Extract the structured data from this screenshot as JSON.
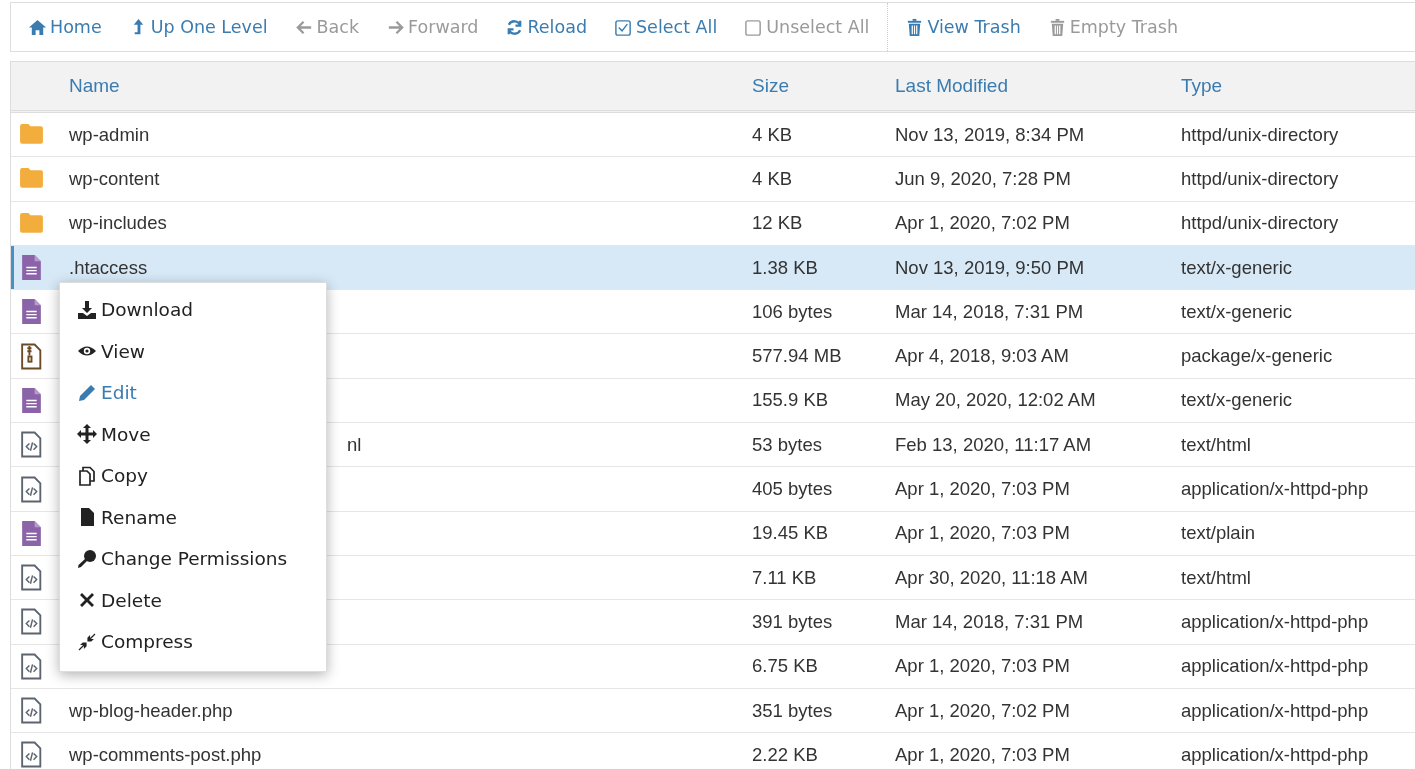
{
  "toolbar": [
    {
      "label": "Home",
      "kind": "home",
      "disabled": false,
      "separator_before": false
    },
    {
      "label": "Up One Level",
      "kind": "up",
      "disabled": false,
      "separator_before": false
    },
    {
      "label": "Back",
      "kind": "back",
      "disabled": true,
      "separator_before": false
    },
    {
      "label": "Forward",
      "kind": "forward",
      "disabled": true,
      "separator_before": false
    },
    {
      "label": "Reload",
      "kind": "reload",
      "disabled": false,
      "separator_before": false
    },
    {
      "label": "Select All",
      "kind": "checked",
      "disabled": false,
      "separator_before": false
    },
    {
      "label": "Unselect All",
      "kind": "unchecked",
      "disabled": true,
      "separator_before": false
    },
    {
      "label": "View Trash",
      "kind": "trash",
      "disabled": false,
      "separator_before": true
    },
    {
      "label": "Empty Trash",
      "kind": "trash",
      "disabled": true,
      "separator_before": false
    }
  ],
  "table": {
    "columns": [
      "Name",
      "Size",
      "Last Modified",
      "Type"
    ],
    "rows": [
      {
        "kind": "folder",
        "name": "wp-admin",
        "size": "4 KB",
        "modified": "Nov 13, 2019, 8:34 PM",
        "type": "httpd/unix-directory",
        "selected": false
      },
      {
        "kind": "folder",
        "name": "wp-content",
        "size": "4 KB",
        "modified": "Jun 9, 2020, 7:28 PM",
        "type": "httpd/unix-directory",
        "selected": false
      },
      {
        "kind": "folder",
        "name": "wp-includes",
        "size": "12 KB",
        "modified": "Apr 1, 2020, 7:02 PM",
        "type": "httpd/unix-directory",
        "selected": false
      },
      {
        "kind": "text",
        "name": ".htaccess",
        "size": "1.38 KB",
        "modified": "Nov 13, 2019, 9:50 PM",
        "type": "text/x-generic",
        "selected": true
      },
      {
        "kind": "text",
        "size": "106 bytes",
        "modified": "Mar 14, 2018, 7:31 PM",
        "type": "text/x-generic",
        "selected": false
      },
      {
        "kind": "archive",
        "size": "577.94 MB",
        "modified": "Apr 4, 2018, 9:03 AM",
        "type": "package/x-generic",
        "selected": false
      },
      {
        "kind": "text",
        "size": "155.9 KB",
        "modified": "May 20, 2020, 12:02 AM",
        "type": "text/x-generic",
        "selected": false
      },
      {
        "kind": "code",
        "name_tail": "nl",
        "size": "53 bytes",
        "modified": "Feb 13, 2020, 11:17 AM",
        "type": "text/html",
        "selected": false
      },
      {
        "kind": "code",
        "size": "405 bytes",
        "modified": "Apr 1, 2020, 7:03 PM",
        "type": "application/x-httpd-php",
        "selected": false
      },
      {
        "kind": "text",
        "size": "19.45 KB",
        "modified": "Apr 1, 2020, 7:03 PM",
        "type": "text/plain",
        "selected": false
      },
      {
        "kind": "code",
        "size": "7.11 KB",
        "modified": "Apr 30, 2020, 11:18 AM",
        "type": "text/html",
        "selected": false
      },
      {
        "kind": "code",
        "size": "391 bytes",
        "modified": "Mar 14, 2018, 7:31 PM",
        "type": "application/x-httpd-php",
        "selected": false
      },
      {
        "kind": "code",
        "size": "6.75 KB",
        "modified": "Apr 1, 2020, 7:03 PM",
        "type": "application/x-httpd-php",
        "selected": false
      },
      {
        "kind": "code",
        "name": "wp-blog-header.php",
        "size": "351 bytes",
        "modified": "Apr 1, 2020, 7:02 PM",
        "type": "application/x-httpd-php",
        "selected": false
      },
      {
        "kind": "code",
        "name": "wp-comments-post.php",
        "size": "2.22 KB",
        "modified": "Apr 1, 2020, 7:03 PM",
        "type": "application/x-httpd-php",
        "selected": false
      }
    ]
  },
  "context_menu": {
    "items": [
      {
        "label": "Download",
        "kind": "download",
        "selected": false
      },
      {
        "label": "View",
        "kind": "eye",
        "selected": false
      },
      {
        "label": "Edit",
        "kind": "pencil",
        "selected": true
      },
      {
        "label": "Move",
        "kind": "move",
        "selected": false
      },
      {
        "label": "Copy",
        "kind": "copy",
        "selected": false
      },
      {
        "label": "Rename",
        "kind": "file",
        "selected": false
      },
      {
        "label": "Change Permissions",
        "kind": "key",
        "selected": false
      },
      {
        "label": "Delete",
        "kind": "x",
        "selected": false
      },
      {
        "label": "Compress",
        "kind": "compress",
        "selected": false
      }
    ]
  }
}
